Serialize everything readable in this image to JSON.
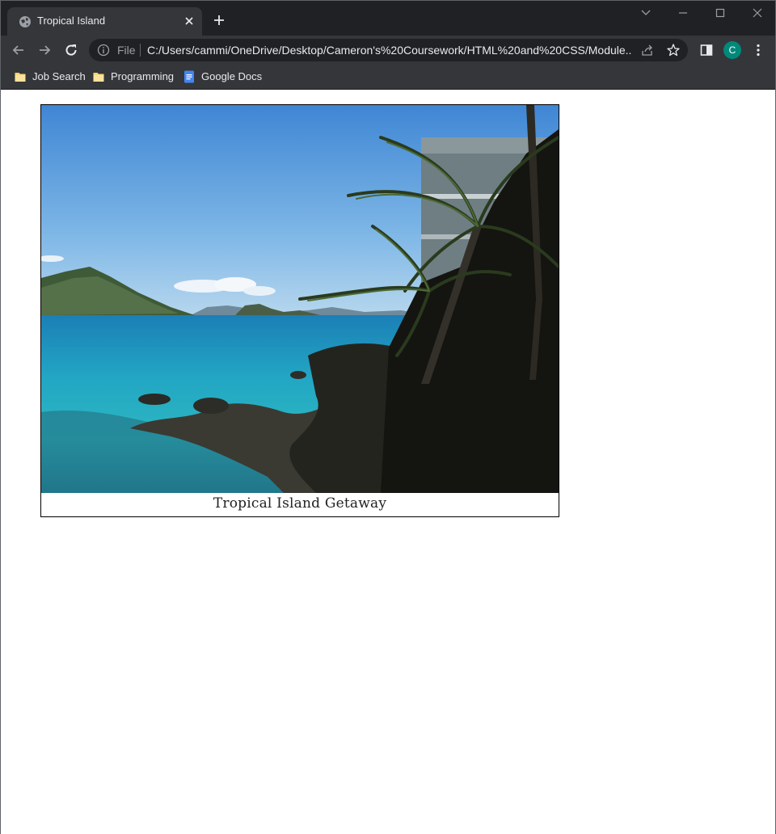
{
  "browser": {
    "tab": {
      "title": "Tropical Island"
    },
    "address": {
      "scheme_label": "File",
      "url": "C:/Users/cammi/OneDrive/Desktop/Cameron's%20Coursework/HTML%20and%20CSS/Module..."
    },
    "profile_initial": "C",
    "bookmarks": [
      {
        "label": "Job Search",
        "icon": "folder-icon"
      },
      {
        "label": "Programming",
        "icon": "folder-icon"
      },
      {
        "label": "Google Docs",
        "icon": "google-docs-icon"
      }
    ]
  },
  "page": {
    "figure": {
      "caption": "Tropical Island Getaway"
    }
  },
  "colors": {
    "chrome_dark": "#202124",
    "chrome_toolbar": "#35363a",
    "profile_avatar": "#00897b",
    "bookmark_folder": "#f6d36b",
    "docs_blue": "#4285f4"
  }
}
